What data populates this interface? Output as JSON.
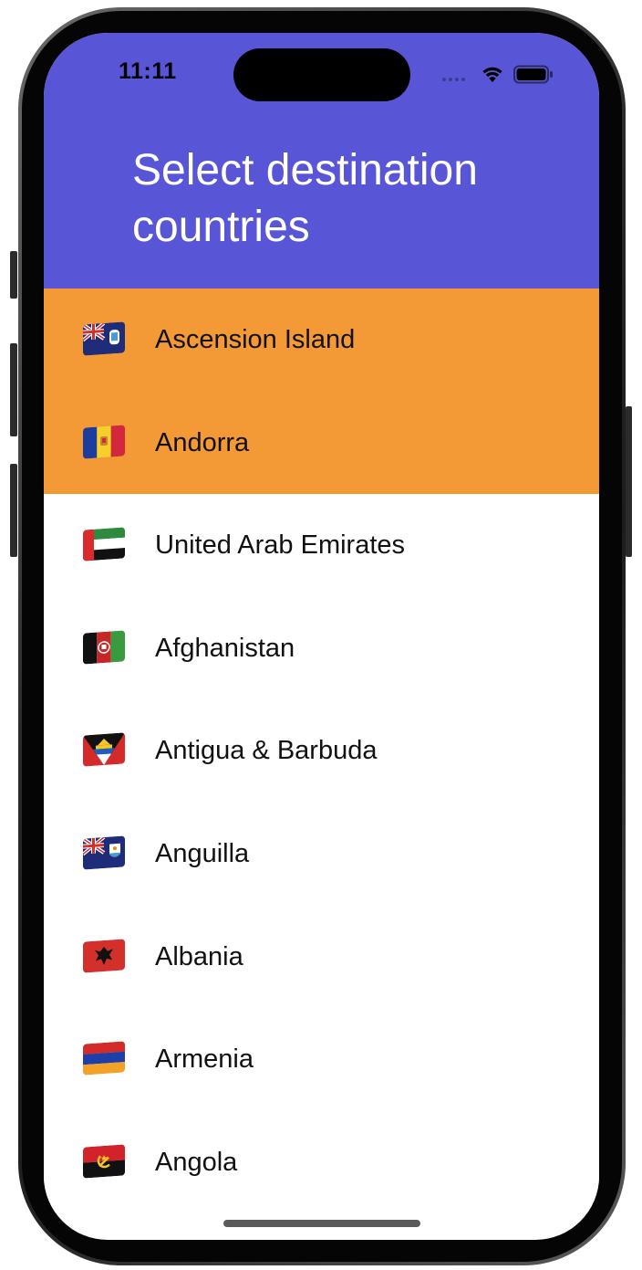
{
  "status_bar": {
    "time": "11:11",
    "icons": [
      "cellular-signal-icon",
      "wifi-icon",
      "battery-icon"
    ]
  },
  "header": {
    "title": "Select destination countries",
    "background_color": "#5856d6"
  },
  "colors": {
    "selected_row": "#f39a37",
    "row": "#ffffff",
    "text": "#111111"
  },
  "countries": [
    {
      "name": "Ascension Island",
      "flag": "ascension-island-flag-icon",
      "selected": true
    },
    {
      "name": "Andorra",
      "flag": "andorra-flag-icon",
      "selected": true
    },
    {
      "name": "United Arab Emirates",
      "flag": "uae-flag-icon",
      "selected": false
    },
    {
      "name": "Afghanistan",
      "flag": "afghanistan-flag-icon",
      "selected": false
    },
    {
      "name": "Antigua & Barbuda",
      "flag": "antigua-barbuda-flag-icon",
      "selected": false
    },
    {
      "name": "Anguilla",
      "flag": "anguilla-flag-icon",
      "selected": false
    },
    {
      "name": "Albania",
      "flag": "albania-flag-icon",
      "selected": false
    },
    {
      "name": "Armenia",
      "flag": "armenia-flag-icon",
      "selected": false
    },
    {
      "name": "Angola",
      "flag": "angola-flag-icon",
      "selected": false
    }
  ]
}
